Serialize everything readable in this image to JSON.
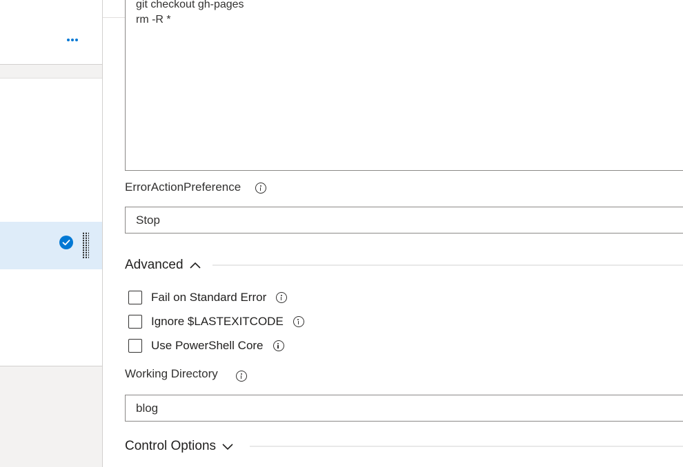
{
  "left_pane": {
    "more_label": "•••",
    "add_label": "+"
  },
  "script": {
    "lines": [
      "git checkout gh-pages",
      "rm -R *"
    ]
  },
  "error_action": {
    "label": "ErrorActionPreference",
    "value": "Stop"
  },
  "advanced": {
    "title": "Advanced",
    "expanded": true,
    "options": [
      {
        "label": "Fail on Standard Error",
        "checked": false
      },
      {
        "label": "Ignore $LASTEXITCODE",
        "checked": false
      },
      {
        "label": "Use PowerShell Core",
        "checked": false
      }
    ]
  },
  "working_directory": {
    "label": "Working Directory",
    "value": "blog"
  },
  "control_options": {
    "title": "Control Options",
    "expanded": false
  },
  "colors": {
    "accent": "#0078d4",
    "selected_row": "#deecf9",
    "pane_bg": "#f3f2f1",
    "border": "#8a8886"
  },
  "icons": [
    "more-icon",
    "add-icon",
    "check-circle-icon",
    "drag-handle-icon",
    "info-icon",
    "chevron-up-icon",
    "chevron-down-icon"
  ]
}
